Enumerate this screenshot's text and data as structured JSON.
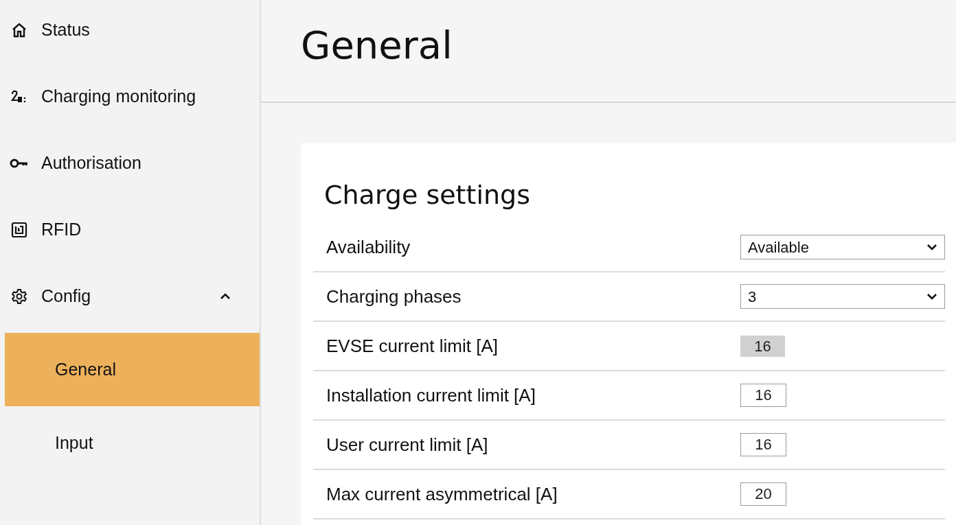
{
  "sidebar": {
    "items": [
      {
        "label": "Status",
        "selected": false
      },
      {
        "label": "Charging monitoring",
        "selected": false
      },
      {
        "label": "Authorisation",
        "selected": false
      },
      {
        "label": "RFID",
        "selected": false
      },
      {
        "label": "Config",
        "selected": false,
        "expanded": true,
        "children": [
          {
            "label": "General",
            "selected": true
          },
          {
            "label": "Input",
            "selected": false
          }
        ]
      }
    ]
  },
  "page": {
    "title": "General"
  },
  "card": {
    "title": "Charge settings",
    "rows": [
      {
        "label": "Availability",
        "kind": "select",
        "value": "Available"
      },
      {
        "label": "Charging phases",
        "kind": "select",
        "value": "3"
      },
      {
        "label": "EVSE current limit [A]",
        "kind": "readonly",
        "value": "16"
      },
      {
        "label": "Installation current limit [A]",
        "kind": "input",
        "value": "16"
      },
      {
        "label": "User current limit [A]",
        "kind": "input",
        "value": "16"
      },
      {
        "label": "Max current asymmetrical [A]",
        "kind": "input",
        "value": "20"
      }
    ]
  }
}
